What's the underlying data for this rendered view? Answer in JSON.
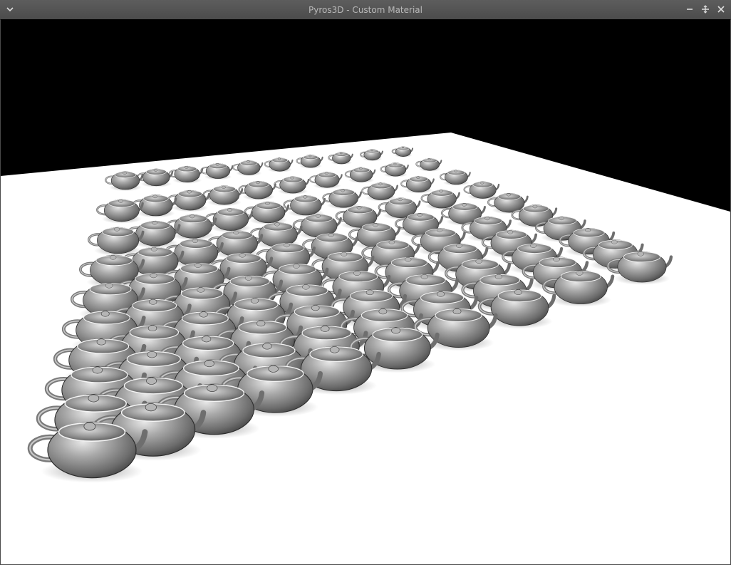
{
  "window": {
    "title": "Pyros3D - Custom Material",
    "buttons": {
      "menu_icon": "chevron-down",
      "minimize_icon": "minimize",
      "maximize_icon": "maximize",
      "close_icon": "close"
    }
  },
  "scene": {
    "background_color": "#000000",
    "floor_color": "#ffffff",
    "object_color": "#8c8c8c",
    "object_type": "teapot-grid"
  }
}
